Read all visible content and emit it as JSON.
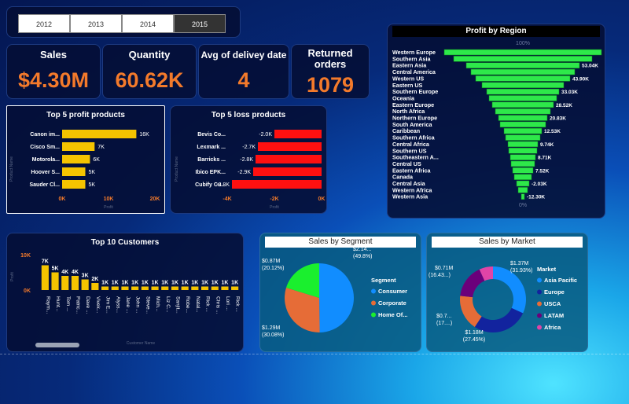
{
  "years": [
    "2012",
    "2013",
    "2014",
    "2015"
  ],
  "selected_year": "2015",
  "kpis": {
    "sales": {
      "label": "Sales",
      "value": "$4.30M"
    },
    "quantity": {
      "label": "Quantity",
      "value": "60.62K"
    },
    "delivery": {
      "label": "Avg of delivey date",
      "value": "4"
    },
    "returned": {
      "label": "Returned orders",
      "value": "1079"
    }
  },
  "chart_data": [
    {
      "type": "bar",
      "orientation": "horizontal",
      "title": "Top 5 profit products",
      "ylabel": "Product Name",
      "xlabel": "Profit",
      "categories": [
        "Canon im...",
        "Cisco Sm...",
        "Motorola...",
        "Hoover S...",
        "Sauder Cl..."
      ],
      "values": [
        16000,
        7000,
        6000,
        5000,
        5000
      ],
      "data_labels": [
        "16K",
        "7K",
        "6K",
        "5K",
        "5K"
      ],
      "xlim": [
        0,
        20000
      ],
      "ticks": [
        "0K",
        "10K",
        "20K"
      ],
      "color": "#f5c400"
    },
    {
      "type": "bar",
      "orientation": "horizontal",
      "title": "Top 5 loss products",
      "ylabel": "Product Name",
      "xlabel": "Profit",
      "categories": [
        "Bevis Co...",
        "Lexmark ...",
        "Barricks ...",
        "Ibico EPK...",
        "Cubify Cu..."
      ],
      "values": [
        -2000,
        -2700,
        -2800,
        -2900,
        -3800
      ],
      "data_labels": [
        "-2.0K",
        "-2.7K",
        "-2.8K",
        "-2.9K",
        "-3.8K"
      ],
      "xlim": [
        -4000,
        0
      ],
      "ticks": [
        "-4K",
        "-2K",
        "0K"
      ],
      "color": "#ff1010"
    },
    {
      "type": "funnel",
      "title": "Profit by Region",
      "top_label": "100%",
      "bottom_label": "0%",
      "categories": [
        "Western Europe",
        "Southern Asia",
        "Eastern Asia",
        "Central America",
        "Western US",
        "Eastern US",
        "Southern Europe",
        "Oceania",
        "Eastern Europe",
        "North Africa",
        "Northern Europe",
        "South America",
        "Caribbean",
        "Southern Africa",
        "Central Africa",
        "Southern US",
        "Southeastern A...",
        "Central US",
        "Eastern Africa",
        "Canada",
        "Central Asia",
        "Western Africa",
        "Western Asia"
      ],
      "values": [
        100,
        88,
        72,
        66,
        60,
        52,
        46,
        43,
        39,
        35,
        31,
        29,
        24,
        22,
        19,
        18,
        16,
        15,
        13,
        11,
        8,
        6,
        2
      ],
      "data_labels": [
        "",
        "",
        "53.04K",
        "",
        "43.90K",
        "",
        "33.03K",
        "",
        "28.52K",
        "",
        "20.83K",
        "",
        "12.53K",
        "",
        "9.74K",
        "",
        "8.71K",
        "",
        "7.52K",
        "",
        "-2.03K",
        "",
        "-12.30K"
      ],
      "color": "#2ee84a"
    },
    {
      "type": "bar",
      "title": "Top 10 Customers",
      "xlabel": "Customer Name",
      "ylabel": "Profit",
      "categories": [
        "Raym...",
        "Hunt...",
        "Tom ...",
        "Patric...",
        "Dave ...",
        "Vivek...",
        "Jim E...",
        "Alyss...",
        "Jane ...",
        "John ...",
        "Steve...",
        "Mich...",
        "Liz C...",
        "Sanjit...",
        "Robe...",
        "Natal...",
        "Rick ...",
        "Chris ...",
        "Lori ...",
        "Rick ..."
      ],
      "values": [
        7000,
        5000,
        4000,
        4000,
        3000,
        2000,
        1000,
        1000,
        1000,
        1000,
        1000,
        1000,
        1000,
        1000,
        1000,
        1000,
        1000,
        1000,
        1000,
        1000
      ],
      "data_labels": [
        "7K",
        "5K",
        "4K",
        "4K",
        "3K",
        "2K",
        "1K",
        "1K",
        "1K",
        "1K",
        "1K",
        "1K",
        "1K",
        "1K",
        "1K",
        "1K",
        "1K",
        "1K",
        "1K",
        "1K"
      ],
      "ylim": [
        0,
        10000
      ],
      "ticks": [
        "0K",
        "10K"
      ],
      "color": "#f5c400"
    },
    {
      "type": "pie",
      "title": "Sales by Segment",
      "legend_title": "Segment",
      "labels": [
        "Consumer",
        "Corporate",
        "Home Of..."
      ],
      "values": [
        2.14,
        1.29,
        0.87
      ],
      "colors": [
        "#118dff",
        "#e66c37",
        "#1aef2e"
      ],
      "data_labels": [
        "$2.14...",
        "(49.8%)",
        "$1.29M",
        "(30.08%)",
        "$0.87M",
        "(20.12%)"
      ]
    },
    {
      "type": "pie",
      "donut": true,
      "title": "Sales by Market",
      "legend_title": "Market",
      "labels": [
        "Asia Pacific",
        "Europe",
        "USCA",
        "LATAM",
        "Africa"
      ],
      "values": [
        1.37,
        1.18,
        0.75,
        0.71,
        0.29
      ],
      "colors": [
        "#118dff",
        "#12239e",
        "#e66c37",
        "#6b007b",
        "#e044a7"
      ],
      "data_labels": [
        "$1.37M",
        "(31.93%)",
        "$1.18M",
        "(27.45%)",
        "$0.7...",
        "(17....)",
        "$0.71M",
        "(16.43...)"
      ]
    }
  ]
}
